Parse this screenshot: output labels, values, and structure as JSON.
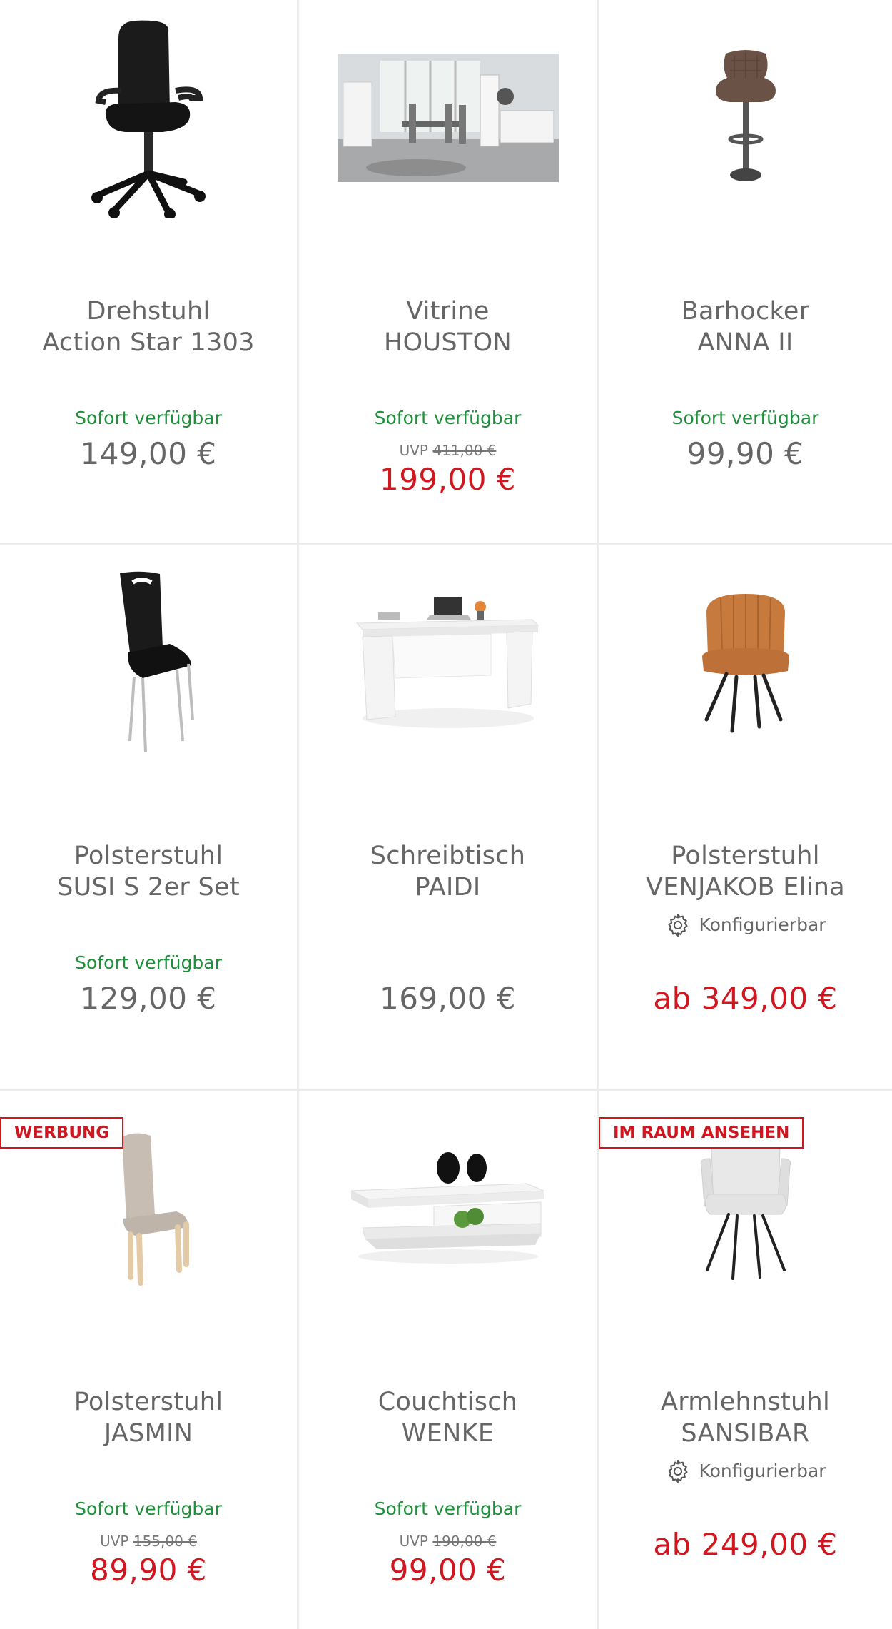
{
  "products": [
    {
      "name_line1": "Drehstuhl",
      "name_line2": "Action Star 1303",
      "availability": "Sofort verfügbar",
      "price": "149,00 €"
    },
    {
      "name_line1": "Vitrine",
      "name_line2": "HOUSTON",
      "availability": "Sofort verfügbar",
      "uvp_label": "UVP",
      "uvp_price": "411,00 €",
      "price": "199,00 €"
    },
    {
      "name_line1": "Barhocker",
      "name_line2": "ANNA II",
      "availability": "Sofort verfügbar",
      "price": "99,90 €"
    },
    {
      "name_line1": "Polsterstuhl",
      "name_line2": "SUSI S 2er Set",
      "availability": "Sofort verfügbar",
      "price": "129,00 €"
    },
    {
      "name_line1": "Schreibtisch",
      "name_line2": "PAIDI",
      "price": "169,00 €"
    },
    {
      "name_line1": "Polsterstuhl",
      "name_line2": "VENJAKOB Elina",
      "configurable": "Konfigurierbar",
      "price": "ab 349,00 €"
    },
    {
      "badge": "WERBUNG",
      "name_line1": "Polsterstuhl",
      "name_line2": "JASMIN",
      "availability": "Sofort verfügbar",
      "uvp_label": "UVP",
      "uvp_price": "155,00 €",
      "price": "89,90 €"
    },
    {
      "name_line1": "Couchtisch",
      "name_line2": "WENKE",
      "availability": "Sofort verfügbar",
      "uvp_label": "UVP",
      "uvp_price": "190,00 €",
      "price": "99,00 €"
    },
    {
      "badge": "IM RAUM ANSEHEN",
      "name_line1": "Armlehnstuhl",
      "name_line2": "SANSIBAR",
      "configurable": "Konfigurierbar",
      "price": "ab 249,00 €"
    }
  ],
  "colors": {
    "accent_red": "#d0161e",
    "available_green": "#1e8f3a",
    "text_gray": "#666666",
    "divider": "#ececec"
  },
  "icons": {
    "configurable": "gear-icon"
  }
}
